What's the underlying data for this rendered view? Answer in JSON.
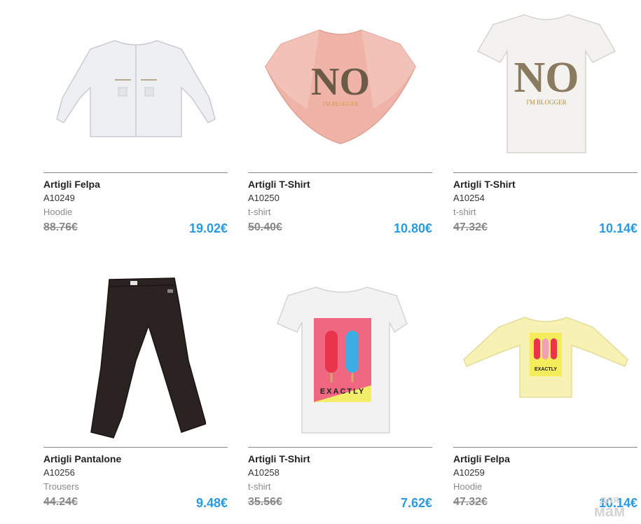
{
  "products": [
    {
      "name": "Artigli Felpa",
      "code": "A10249",
      "category": "Hoodie",
      "old_price": "88.76€",
      "price": "19.02€",
      "image": "white-knit-jacket"
    },
    {
      "name": "Artigli T-Shirt",
      "code": "A10250",
      "category": "t-shirt",
      "old_price": "50.40€",
      "price": "10.80€",
      "image": "pink-no-cape-top",
      "print": "NO",
      "print_sub": "I'M BLOGGER"
    },
    {
      "name": "Artigli T-Shirt",
      "code": "A10254",
      "category": "t-shirt",
      "old_price": "47.32€",
      "price": "10.14€",
      "image": "white-no-tshirt",
      "print": "NO",
      "print_sub": "I'M BLOGGER"
    },
    {
      "name": "Artigli Pantalone",
      "code": "A10256",
      "category": "Trousers",
      "old_price": "44.24€",
      "price": "9.48€",
      "image": "black-trousers"
    },
    {
      "name": "Artigli T-Shirt",
      "code": "A10258",
      "category": "t-shirt",
      "old_price": "35.56€",
      "price": "7.62€",
      "image": "white-exactly-tshirt",
      "print": "EXACTLY"
    },
    {
      "name": "Artigli Felpa",
      "code": "A10259",
      "category": "Hoodie",
      "old_price": "47.32€",
      "price": "10.14€",
      "image": "yellow-exactly-sweatshirt",
      "print": "EXACTLY"
    }
  ],
  "watermark": {
    "line1": "для",
    "line2": "мам"
  },
  "colors": {
    "price": "#2a9be0",
    "old_price": "#888888",
    "divider": "#8a8a8a"
  }
}
